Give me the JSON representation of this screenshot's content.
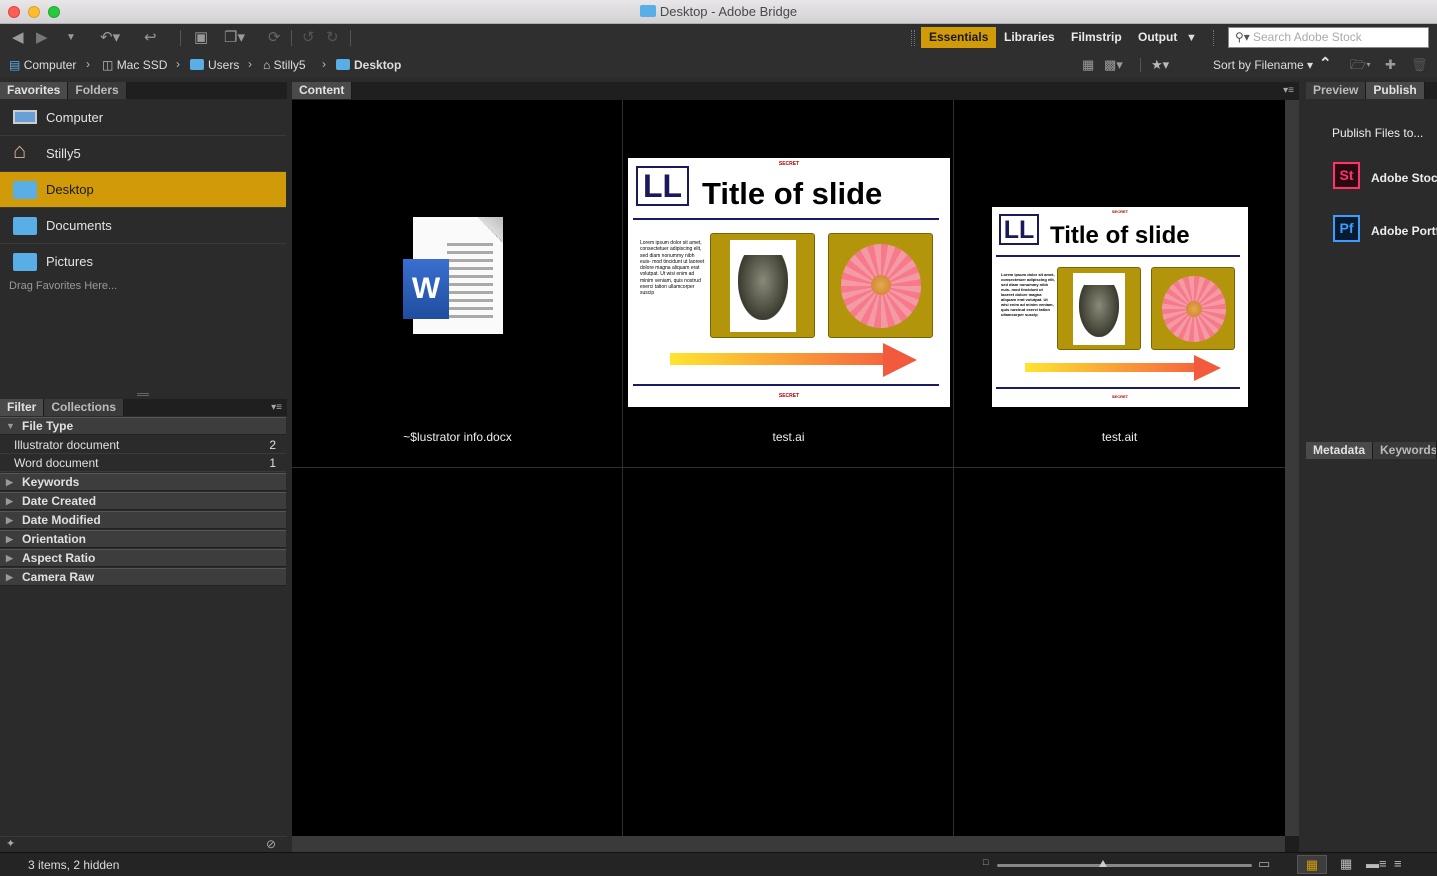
{
  "window": {
    "title": "Desktop - Adobe Bridge"
  },
  "toolbar": {
    "workspaces": [
      "Essentials",
      "Libraries",
      "Filmstrip",
      "Output"
    ],
    "search_placeholder": "Search Adobe Stock"
  },
  "path": [
    "Computer",
    "Mac SSD",
    "Users",
    "Stilly5",
    "Desktop"
  ],
  "sort": {
    "label": "Sort by Filename"
  },
  "favorites": {
    "tabs": [
      "Favorites",
      "Folders"
    ],
    "items": [
      "Computer",
      "Stilly5",
      "Desktop",
      "Documents",
      "Pictures"
    ],
    "selected": "Desktop",
    "hint": "Drag Favorites Here..."
  },
  "filter": {
    "tabs": [
      "Filter",
      "Collections"
    ],
    "file_type": {
      "label": "File Type",
      "rows": [
        {
          "label": "Illustrator document",
          "count": "2"
        },
        {
          "label": "Word document",
          "count": "1"
        }
      ]
    },
    "sections": [
      "Keywords",
      "Date Created",
      "Date Modified",
      "Orientation",
      "Aspect Ratio",
      "Camera Raw"
    ]
  },
  "content": {
    "tab": "Content",
    "items": [
      {
        "name": "~$lustrator info.docx",
        "icon": "word-document-icon"
      },
      {
        "name": "test.ai"
      },
      {
        "name": "test.ait"
      }
    ],
    "slide": {
      "logo": "LL",
      "title": "Title of slide",
      "secret": "SECRET",
      "body": "Lorem ipsum dolor sit amet, consectetuer adipiscing elit, sed diam nonummy nibh euis- mod tincidunt ut laoreet dolore magna aliquam erat volutpat. Ut wisi enim ad minim veniam, quis nostrud exerci tation ullamcorper suscip"
    }
  },
  "right": {
    "tabs_top": [
      "Preview",
      "Publish"
    ],
    "publish_heading": "Publish Files to...",
    "services": [
      {
        "abbr": "St",
        "label": "Adobe Stock",
        "color": "#ff3366"
      },
      {
        "abbr": "Pf",
        "label": "Adobe Portfolio",
        "color": "#3d9bff"
      }
    ],
    "tabs_bottom": [
      "Metadata",
      "Keywords"
    ]
  },
  "status": {
    "text": "3 items, 2 hidden"
  },
  "colors": {
    "accent": "#d19a08"
  }
}
